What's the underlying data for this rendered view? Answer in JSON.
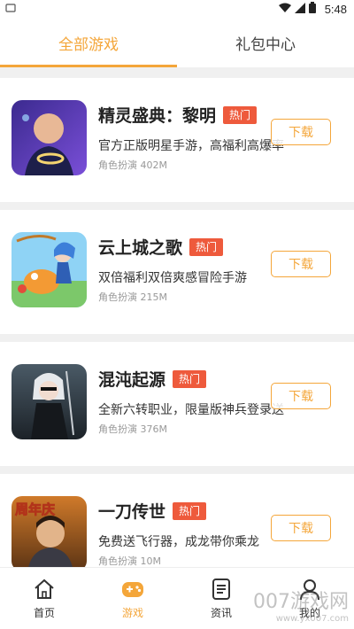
{
  "status_bar": {
    "time": "5:48"
  },
  "tabs": [
    {
      "label": "全部游戏",
      "active": true
    },
    {
      "label": "礼包中心",
      "active": false
    }
  ],
  "games": [
    {
      "title": "精灵盛典：黎明",
      "badge": "热门",
      "desc": "官方正版明星手游，高福利高爆率",
      "meta": "角色扮演  402M",
      "button": "下载",
      "icon": "game-icon-jinglingshengdian"
    },
    {
      "title": "云上城之歌",
      "badge": "热门",
      "desc": "双倍福利双倍爽感冒险手游",
      "meta": "角色扮演  215M",
      "button": "下载",
      "icon": "game-icon-yunshangcheng"
    },
    {
      "title": "混沌起源",
      "badge": "热门",
      "desc": "全新六转职业，限量版神兵登录送",
      "meta": "角色扮演  376M",
      "button": "下载",
      "icon": "game-icon-hundunqiyuan"
    },
    {
      "title": "一刀传世",
      "badge": "热门",
      "desc": "免费送飞行器，成龙带你乘龙",
      "meta": "角色扮演  10M",
      "button": "下载",
      "icon": "game-icon-yidaochuanshi",
      "icon_text": "周年庆"
    }
  ],
  "bottom_nav": [
    {
      "label": "首页",
      "icon": "home-icon",
      "active": false
    },
    {
      "label": "游戏",
      "icon": "gamepad-icon",
      "active": true
    },
    {
      "label": "资讯",
      "icon": "news-icon",
      "active": false
    },
    {
      "label": "我的",
      "icon": "user-icon",
      "active": false
    }
  ],
  "watermark": {
    "text": "007游戏网",
    "sub": "www.yx007.com"
  },
  "colors": {
    "accent": "#f4a63a",
    "hot_badge": "#ee5a3c",
    "separator": "#f0f0f0"
  }
}
